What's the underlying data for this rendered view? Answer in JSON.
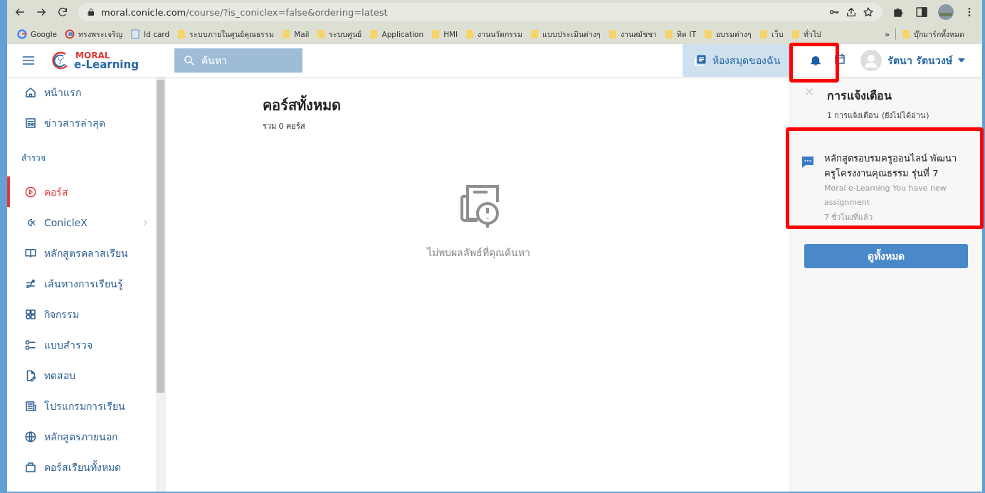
{
  "browser": {
    "url_host": "moral.conicle.com",
    "url_path": "/course/?is_coniclex=false&ordering=latest"
  },
  "bookmarks": [
    {
      "label": "Google",
      "kind": "google"
    },
    {
      "label": "ทรงพระเจริญ",
      "kind": "site"
    },
    {
      "label": "Id card",
      "kind": "page"
    },
    {
      "label": "ระบบภายในศูนย์คุณธรรม",
      "kind": "folder"
    },
    {
      "label": "Mail",
      "kind": "folder"
    },
    {
      "label": "ระบบศูนย์",
      "kind": "folder"
    },
    {
      "label": "Application",
      "kind": "folder"
    },
    {
      "label": "HMI",
      "kind": "folder"
    },
    {
      "label": "งานนวัตกรรม",
      "kind": "folder"
    },
    {
      "label": "แบบประเมินต่างๆ",
      "kind": "folder"
    },
    {
      "label": "งานสมัชชา",
      "kind": "folder"
    },
    {
      "label": "ทิด IT",
      "kind": "folder"
    },
    {
      "label": "อบรมต่างๆ",
      "kind": "folder"
    },
    {
      "label": "เว็บ",
      "kind": "folder"
    },
    {
      "label": "ทั่วไป",
      "kind": "folder"
    }
  ],
  "bookmarks_more": "»",
  "all_bookmarks": "บุ๊กมาร์กทั้งหมด",
  "header": {
    "logo_top": "MORAL",
    "logo_bottom": "e-Learning",
    "search_placeholder": "ค้นหา",
    "library": "ห้องสมุดของฉัน",
    "user_name": "รัตนา รัตนวงษ์",
    "bell_highlighted": true
  },
  "sidebar": {
    "items": [
      {
        "label": "หน้าแรก",
        "kind": "link",
        "selected": false
      },
      {
        "label": "ข่าวสารล่าสุด",
        "kind": "link",
        "selected": false
      },
      {
        "label": "สำรวจ",
        "kind": "section"
      },
      {
        "label": "คอร์ส",
        "kind": "link",
        "selected": true
      },
      {
        "label": "ConicleX",
        "kind": "submenu",
        "selected": false
      },
      {
        "label": "หลักสูตรคลาสเรียน",
        "kind": "link",
        "selected": false
      },
      {
        "label": "เส้นทางการเรียนรู้",
        "kind": "link",
        "selected": false
      },
      {
        "label": "กิจกรรม",
        "kind": "link",
        "selected": false
      },
      {
        "label": "แบบสำรวจ",
        "kind": "link",
        "selected": false
      },
      {
        "label": "ทดสอบ",
        "kind": "link",
        "selected": false
      },
      {
        "label": "โปรแกรมการเรียน",
        "kind": "link",
        "selected": false
      },
      {
        "label": "หลักสูตรภายนอก",
        "kind": "link",
        "selected": false
      },
      {
        "label": "คอร์สเรียนทั้งหมด",
        "kind": "link",
        "selected": false
      }
    ]
  },
  "main": {
    "title": "คอร์สทั้งหมด",
    "count": "รวม 0 คอร์ส",
    "empty_message": "ไม่พบผลลัพธ์ที่คุณค้นหา"
  },
  "notifications": {
    "title": "การแจ้งเตือน",
    "summary": "1 การแจ้งเตือน (ยังไม่ได้อ่าน)",
    "items": [
      {
        "title": "หลักสูตรอบรมครูออนไลน์ พัฒนาครูโครงงานคุณธรรม รุ่นที่ 7",
        "body": "Moral e-Learning You have new assignment",
        "time": "7 ชั่วโมงที่แล้ว",
        "highlighted": true
      }
    ],
    "view_all": "ดูทั้งหมด"
  }
}
